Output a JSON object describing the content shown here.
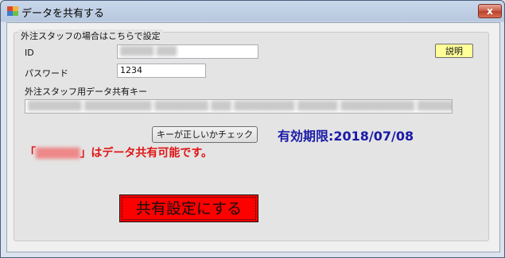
{
  "window": {
    "title": "データを共有する",
    "close_label": "x"
  },
  "group": {
    "title": "外注スタッフの場合はこちらで設定"
  },
  "fields": {
    "id_label": "ID",
    "id_value": "",
    "password_label": "パスワード",
    "password_value": "1234",
    "key_label": "外注スタッフ用データ共有キー",
    "key_value": ""
  },
  "buttons": {
    "help": "説明",
    "check_key": "キーが正しいかチェック",
    "share": "共有設定にする"
  },
  "expiry": "有効期限:2018/07/08",
  "status": {
    "open_quote": "「",
    "suffix": "」はデータ共有可能です。"
  },
  "colors": {
    "expiry_text": "#1a1aa8",
    "status_text": "#e01515",
    "share_button_bg": "#ff0000",
    "help_button_bg": "#ffff99"
  }
}
